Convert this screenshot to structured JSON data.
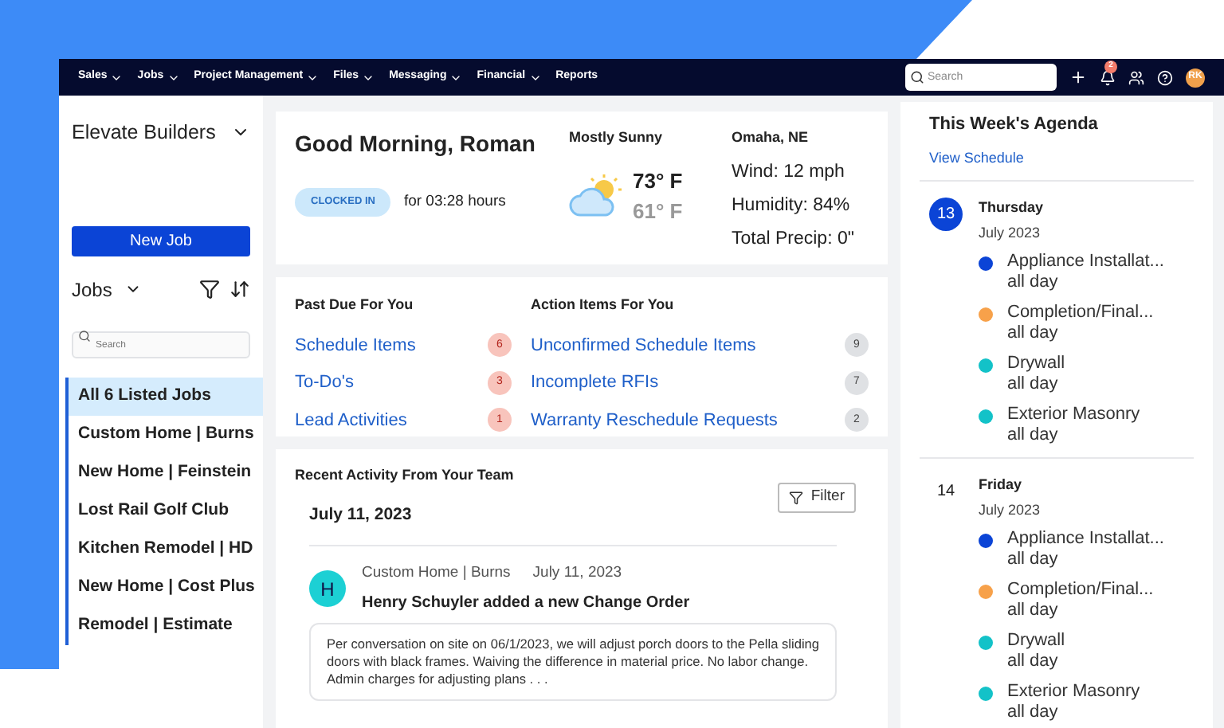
{
  "nav": {
    "menus": [
      {
        "label": "Sales"
      },
      {
        "label": "Jobs"
      },
      {
        "label": "Project Management"
      },
      {
        "label": "Files"
      },
      {
        "label": "Messaging"
      },
      {
        "label": "Financial"
      },
      {
        "label": "Reports",
        "caret": false
      }
    ],
    "search": {
      "placeholder": "Search"
    },
    "notifications": "2",
    "avatar": "RK"
  },
  "sidebar": {
    "company": "Elevate Builders",
    "new_job": "New Job",
    "jobs_label": "Jobs",
    "search": {
      "placeholder": "Search"
    },
    "items": [
      {
        "label": "All 6 Listed Jobs",
        "selected": true
      },
      {
        "label": "Custom Home | Burns",
        "selected": false
      },
      {
        "label": "New Home | Feinstein",
        "selected": false
      },
      {
        "label": "Lost Rail Golf Club",
        "selected": false
      },
      {
        "label": "Kitchen Remodel | HD",
        "selected": false
      },
      {
        "label": "New Home | Cost Plus",
        "selected": false
      },
      {
        "label": "Remodel | Estimate",
        "selected": false
      }
    ]
  },
  "greeting": {
    "title": "Good Morning, Roman",
    "status": "CLOCKED IN",
    "duration": "for 03:28 hours"
  },
  "weather": {
    "condition": "Mostly Sunny",
    "high": "73° F",
    "low": "61° F",
    "location": "Omaha, NE",
    "details": [
      "Wind: 12 mph",
      "Humidity: 84%",
      "Total Precip: 0\""
    ]
  },
  "past_due": {
    "title": "Past Due For You",
    "items": [
      {
        "label": "Schedule Items",
        "count": "6"
      },
      {
        "label": "To-Do's",
        "count": "3"
      },
      {
        "label": "Lead Activities",
        "count": "1"
      }
    ]
  },
  "action_items": {
    "title": "Action Items For You",
    "items": [
      {
        "label": "Unconfirmed Schedule Items",
        "count": "9"
      },
      {
        "label": "Incomplete RFIs",
        "count": "7"
      },
      {
        "label": "Warranty Reschedule Requests",
        "count": "2"
      }
    ]
  },
  "activity": {
    "title": "Recent Activity From Your Team",
    "filter": "Filter",
    "date": "July 11, 2023",
    "entries": [
      {
        "avatar": "H",
        "job": "Custom Home | Burns",
        "date": "July 11, 2023",
        "headline": "Henry Schuyler added a new Change Order",
        "body": "Per conversation on site on 06/1/2023, we will adjust porch doors to the Pella sliding doors with black frames. Waiving the difference in material price. No labor change. Admin charges for adjusting plans . . ."
      }
    ]
  },
  "agenda": {
    "title": "This Week's Agenda",
    "link": "View Schedule",
    "days": [
      {
        "day": "13",
        "weekday": "Thursday",
        "month": "July 2023",
        "selected": true,
        "events": [
          {
            "name": "Appliance Installat...",
            "time": "all day",
            "color": "#0b44d6"
          },
          {
            "name": "Completion/Final...",
            "time": "all day",
            "color": "#f7a14a"
          },
          {
            "name": "Drywall",
            "time": "all day",
            "color": "#13c2c8"
          },
          {
            "name": "Exterior Masonry",
            "time": "all day",
            "color": "#13c2c8"
          }
        ]
      },
      {
        "day": "14",
        "weekday": "Friday",
        "month": "July 2023",
        "selected": false,
        "events": [
          {
            "name": "Appliance Installat...",
            "time": "all day",
            "color": "#0b44d6"
          },
          {
            "name": "Completion/Final...",
            "time": "all day",
            "color": "#f7a14a"
          },
          {
            "name": "Drywall",
            "time": "all day",
            "color": "#13c2c8"
          },
          {
            "name": "Exterior Masonry",
            "time": "all day",
            "color": "#13c2c8"
          }
        ]
      }
    ]
  }
}
